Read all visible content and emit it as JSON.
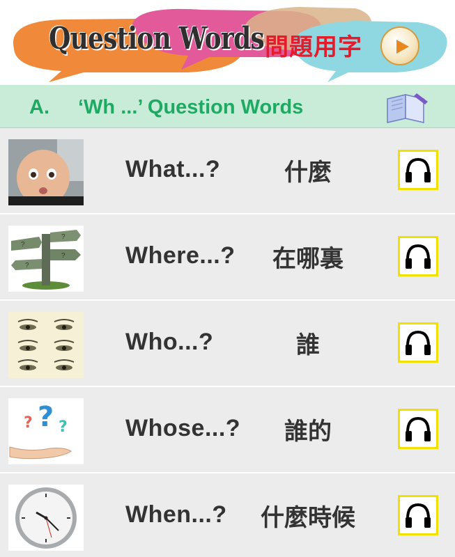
{
  "header": {
    "title_en": "Question Words",
    "title_zh": "問題用字",
    "play_icon": "play-icon"
  },
  "section": {
    "letter": "A.",
    "title": "‘Wh ...’ Question Words",
    "icon": "book-icon"
  },
  "items": [
    {
      "word_en": "What...?",
      "word_zh": "什麼",
      "thumb_icon": "baby-face-image",
      "audio_icon": "headphones-icon"
    },
    {
      "word_en": "Where...?",
      "word_zh": "在哪裏",
      "thumb_icon": "signpost-image",
      "audio_icon": "headphones-icon"
    },
    {
      "word_en": "Who...?",
      "word_zh": "誰",
      "thumb_icon": "eyes-image",
      "audio_icon": "headphones-icon"
    },
    {
      "word_en": "Whose...?",
      "word_zh": "誰的",
      "thumb_icon": "question-marks-hand-image",
      "audio_icon": "headphones-icon"
    },
    {
      "word_en": "When...?",
      "word_zh": "什麼時候",
      "thumb_icon": "clock-image",
      "audio_icon": "headphones-icon"
    }
  ],
  "colors": {
    "section_bg": "#c9ecd9",
    "section_text": "#1faa63",
    "title_zh": "#e31b2b",
    "row_bg": "#ececec",
    "audio_border": "#f2e100"
  }
}
